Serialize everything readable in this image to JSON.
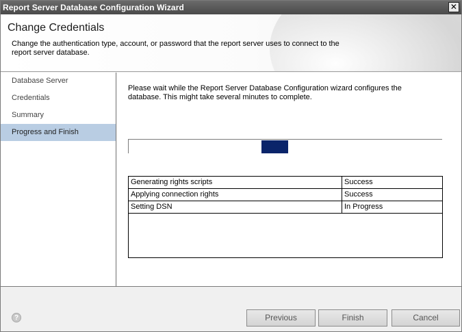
{
  "window": {
    "title": "Report Server Database Configuration Wizard",
    "close_glyph": "✕"
  },
  "banner": {
    "title": "Change Credentials",
    "description": "Change the authentication type, account, or password that the report server uses to connect to the report server database."
  },
  "nav": {
    "items": [
      {
        "label": "Database Server",
        "active": false
      },
      {
        "label": "Credentials",
        "active": false
      },
      {
        "label": "Summary",
        "active": false
      },
      {
        "label": "Progress and Finish",
        "active": true
      }
    ]
  },
  "main": {
    "intro": "Please wait while the Report Server Database Configuration wizard configures the database.  This might take several minutes to complete.",
    "progress": {
      "style": "marquee",
      "accent": "#0a246a"
    },
    "table": {
      "rows": [
        {
          "action": "Generating rights scripts",
          "status": "Success"
        },
        {
          "action": "Applying connection rights",
          "status": "Success"
        },
        {
          "action": "Setting DSN",
          "status": "In Progress"
        }
      ]
    }
  },
  "footer": {
    "help_icon": "help-icon",
    "help_glyph": "?",
    "previous_label": "Previous",
    "finish_label": "Finish",
    "cancel_label": "Cancel"
  }
}
